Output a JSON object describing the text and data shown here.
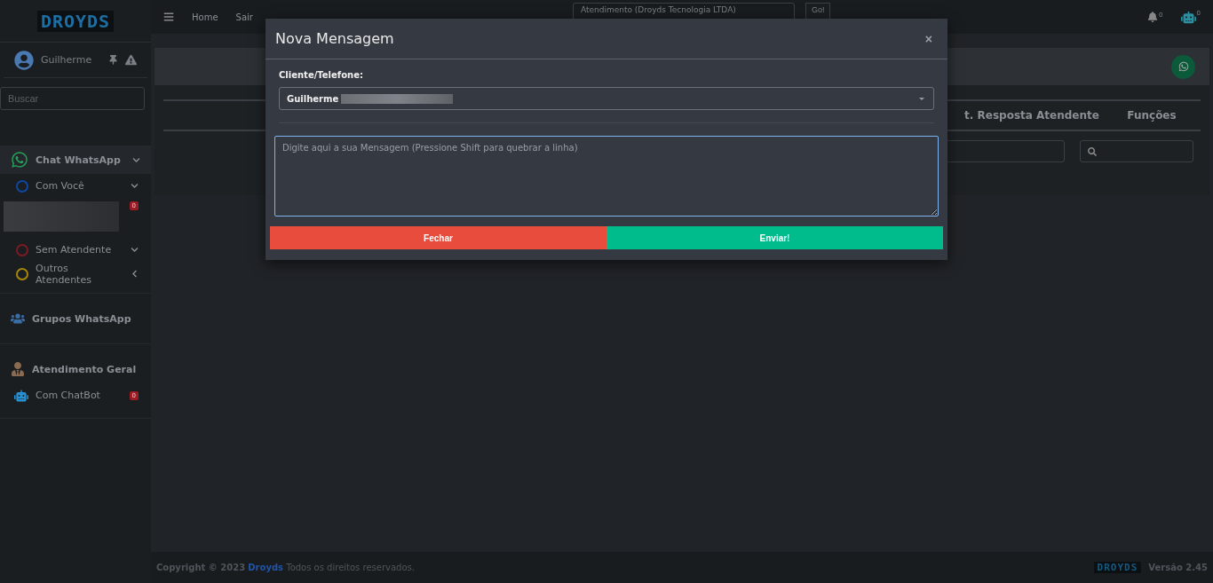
{
  "brand": {
    "logo": "DROYDS"
  },
  "topbar": {
    "nav": [
      "Home",
      "Sair"
    ],
    "company_select": "Atendimento (Droyds Tecnologia LTDA)",
    "go_button": "Go!",
    "notification_count": "0",
    "avatar_count": "0"
  },
  "sidebar": {
    "user": "Guilherme",
    "search": {
      "placeholder": "Buscar"
    },
    "groups": [
      {
        "label": "Chat WhatsApp",
        "expanded": true,
        "items": [
          {
            "kind": "status",
            "label": "Com Você",
            "color": "#0d47a1",
            "expanded": true
          },
          {
            "kind": "contact",
            "badge": "0"
          },
          {
            "kind": "status",
            "label": "Sem Atendente",
            "color": "#7a1a22",
            "expanded": true
          },
          {
            "kind": "status",
            "label": "Outros Atendentes",
            "color": "#a8860b",
            "expanded": false
          }
        ]
      },
      {
        "label": "Grupos WhatsApp"
      },
      {
        "label": "Atendimento Geral",
        "items": [
          {
            "kind": "bot",
            "label": "Com ChatBot",
            "badge": "0"
          }
        ]
      }
    ]
  },
  "table": {
    "columns": [
      "t. Resposta Atendente",
      "Funções"
    ]
  },
  "modal": {
    "title": "Nova Mensagem",
    "close": "×",
    "client_label": "Cliente/Telefone:",
    "client_value": "Guilherme",
    "message": {
      "placeholder": "Digite aqui a sua Mensagem (Pressione Shift para quebrar a linha)"
    },
    "buttons": [
      {
        "kind": "close",
        "label": "Fechar"
      },
      {
        "kind": "send",
        "label": "Enviar!"
      }
    ]
  },
  "footer": {
    "logo": "DROYDS",
    "copyright": "Copyright © 2023",
    "company": "Droyds",
    "rights": "Todos os direitos reservados.",
    "version": "Versão 2.45"
  }
}
